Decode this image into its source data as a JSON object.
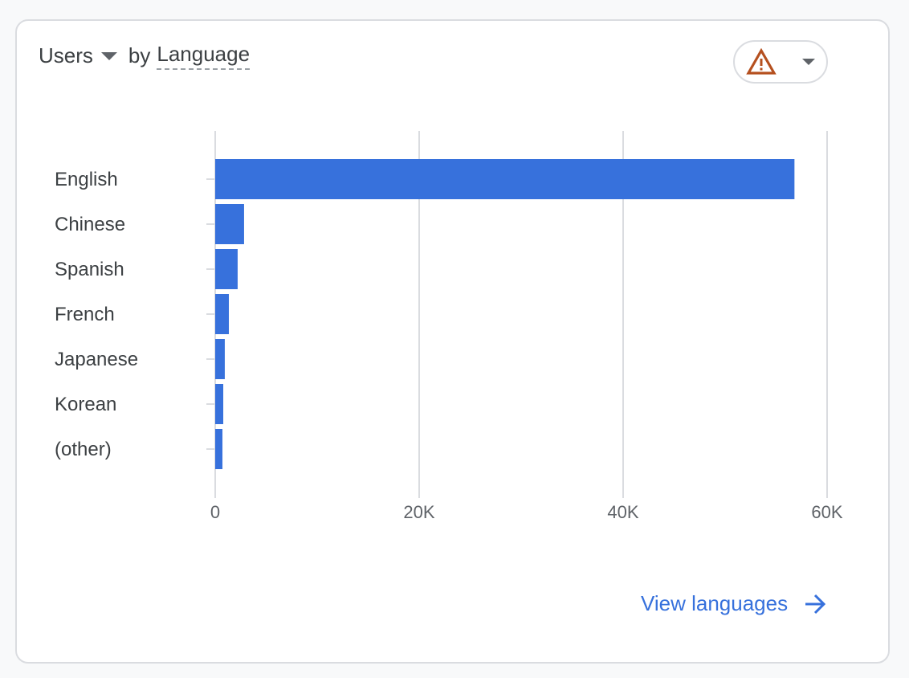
{
  "header": {
    "metric_label": "Users",
    "by_label": "by",
    "dimension_label": "Language"
  },
  "warning_button": {
    "icon": "warning-icon",
    "color": "#b5501f"
  },
  "footer": {
    "link_label": "View languages",
    "link_icon": "arrow-right-icon"
  },
  "colors": {
    "bar": "#3771dc",
    "grid": "#dadce0",
    "text": "#3c4043",
    "axis_text": "#5f6368"
  },
  "chart_data": {
    "type": "bar",
    "orientation": "horizontal",
    "title": "Users by Language",
    "categories": [
      "English",
      "Chinese",
      "Spanish",
      "French",
      "Japanese",
      "Korean",
      "(other)"
    ],
    "values": [
      56800,
      2830,
      2200,
      1340,
      940,
      790,
      710
    ],
    "xlabel": "",
    "ylabel": "",
    "xlim": [
      0,
      60000
    ],
    "x_ticks": [
      0,
      20000,
      40000,
      60000
    ],
    "x_tick_labels": [
      "0",
      "20K",
      "40K",
      "60K"
    ],
    "grid": true,
    "legend": "none"
  }
}
